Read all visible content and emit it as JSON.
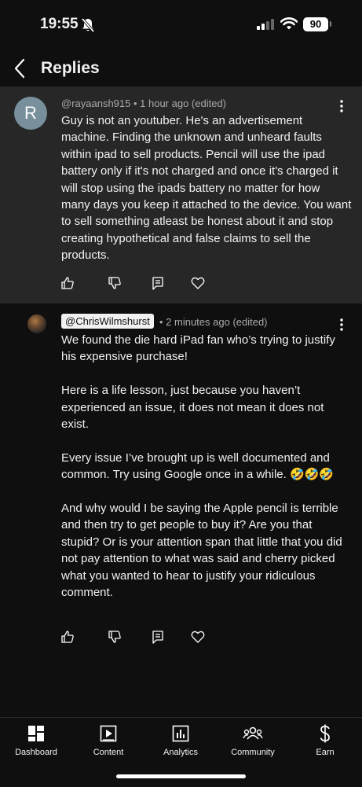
{
  "status_bar": {
    "time": "19:55",
    "battery": "90"
  },
  "header": {
    "title": "Replies"
  },
  "parent_comment": {
    "avatar_letter": "R",
    "author": "@rayaansh915",
    "meta": " • 1 hour ago (edited)",
    "text": "Guy is not an youtuber.  He's an advertisement machine. Finding the unknown and unheard faults within ipad to sell products. Pencil will  use the ipad battery only if it's not charged and once it's charged it will stop using the ipads battery no matter for how many days you keep it attached to the device. You want to sell something atleast be honest about it and stop creating hypothetical and false claims to sell the products."
  },
  "reply": {
    "author": "@ChrisWilmshurst",
    "meta": "• 2 minutes ago (edited)",
    "text": "We found the die hard iPad fan who’s trying to justify his expensive purchase!\n\nHere is a life lesson, just because you haven’t experienced an issue, it does not mean it does not exist.\n\nEvery issue I’ve brought up is well documented and common. Try using Google once in a while. 🤣🤣🤣\n\nAnd why would I be saying the Apple pencil is terrible and then try to get people to buy it? Are you that stupid? Or is your attention span that little that you did not pay attention to what was said and cherry picked what you wanted to hear to justify your ridiculous comment."
  },
  "nav": [
    {
      "label": "Dashboard",
      "icon": "dashboard-icon"
    },
    {
      "label": "Content",
      "icon": "content-icon"
    },
    {
      "label": "Analytics",
      "icon": "analytics-icon"
    },
    {
      "label": "Community",
      "icon": "community-icon"
    },
    {
      "label": "Earn",
      "icon": "earn-icon"
    }
  ]
}
